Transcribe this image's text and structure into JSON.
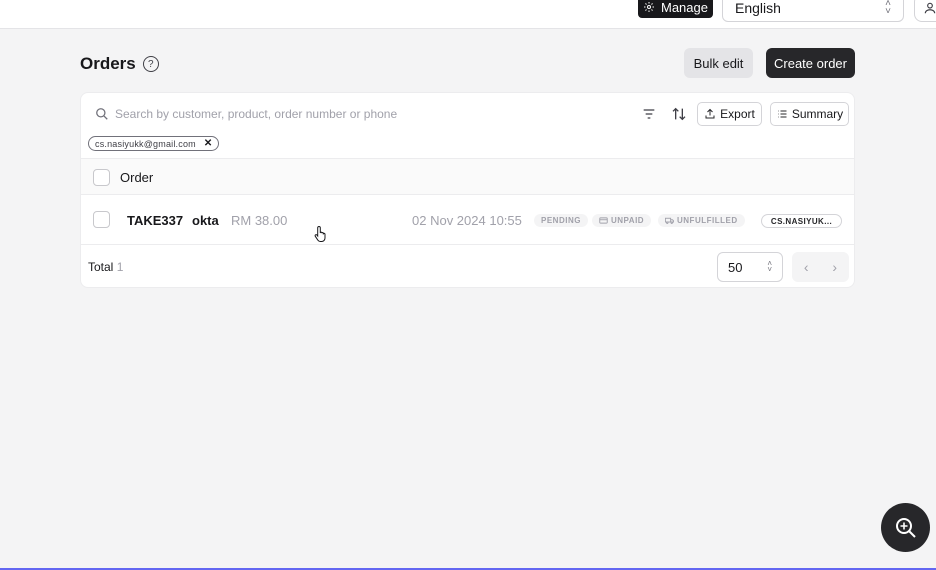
{
  "topbar": {
    "manage_label": "Manage",
    "language": "English"
  },
  "page": {
    "title": "Orders"
  },
  "actions": {
    "bulk_edit_label": "Bulk edit",
    "create_order_label": "Create order"
  },
  "search": {
    "placeholder": "Search by customer, product, order number or phone",
    "value": "",
    "export_label": "Export",
    "summary_label": "Summary",
    "active_filter": "cs.nasiyukk@gmail.com",
    "remove_filter_glyph": "✕"
  },
  "table": {
    "header_label": "Order",
    "rows": [
      {
        "order_id": "TAKE337",
        "customer": "okta",
        "amount": "RM 38.00",
        "datetime": "02 Nov 2024 10:55",
        "status": "PENDING",
        "payment": "UNPAID",
        "fulfillment": "UNFULFILLED",
        "email_badge": "CS.NASIYUK..."
      }
    ]
  },
  "footer": {
    "total_label": "Total",
    "total_count": "1",
    "page_size": "50",
    "prev_glyph": "‹",
    "next_glyph": "›"
  },
  "icons": {
    "manage": "gear-icon",
    "help": "help-circle-icon",
    "search": "search-icon",
    "filter": "filter-icon",
    "sort": "sort-icon",
    "export": "upload-icon",
    "summary": "list-icon",
    "unpaid": "credit-card-icon",
    "unfulfilled": "truck-icon",
    "fab": "zoom-sparkle-icon",
    "user": "user-icon"
  },
  "colors": {
    "primary_dark": "#27272a",
    "page_bg": "#f4f4f5",
    "muted_text": "#a1a1aa"
  }
}
